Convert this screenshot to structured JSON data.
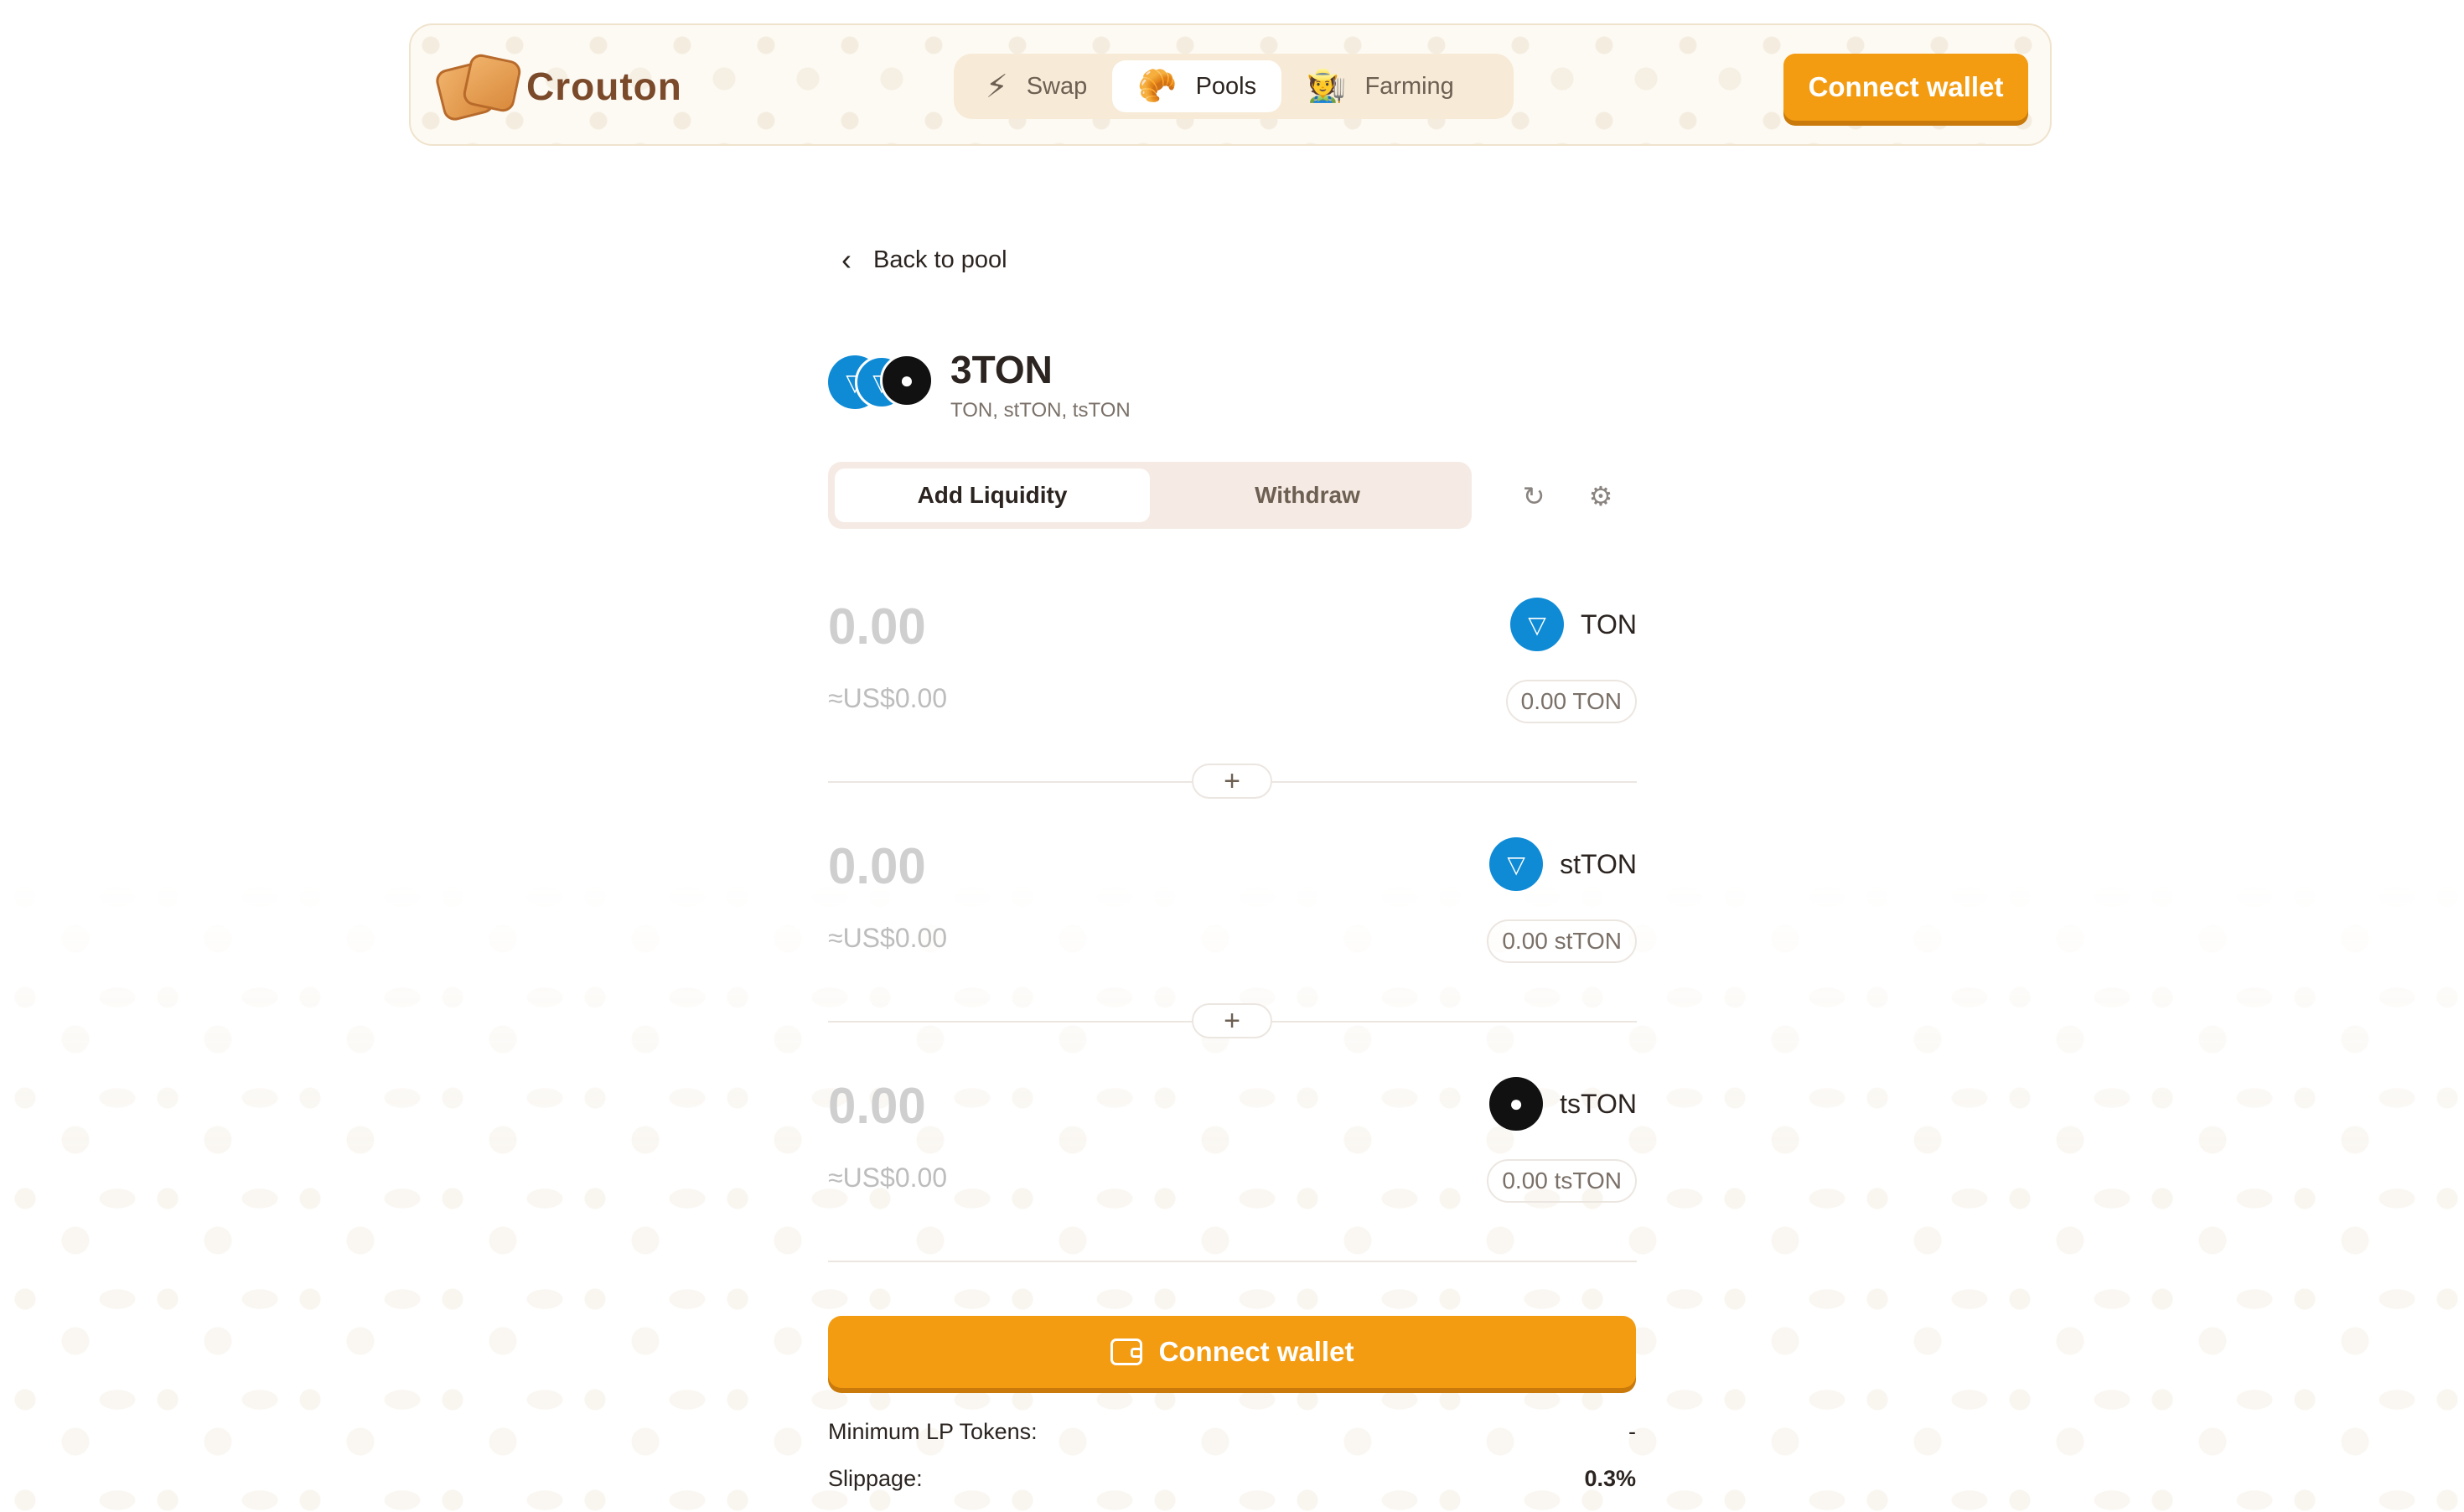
{
  "header": {
    "brand": "Crouton",
    "nav": [
      {
        "label": "Swap",
        "icon": "⚡"
      },
      {
        "label": "Pools",
        "icon": "🥐"
      },
      {
        "label": "Farming",
        "icon": "🧑‍🌾"
      }
    ],
    "connect_label": "Connect wallet"
  },
  "back_label": "Back to pool",
  "pool": {
    "name": "3TON",
    "tokens": "TON, stTON, tsTON"
  },
  "tabs": {
    "add": "Add Liquidity",
    "withdraw": "Withdraw"
  },
  "tools": {
    "refresh_icon": "↻",
    "settings_icon": "⚙"
  },
  "rows": [
    {
      "amount": "0.00",
      "usd": "≈US$0.00",
      "token": "TON",
      "balance": "0.00 TON"
    },
    {
      "amount": "0.00",
      "usd": "≈US$0.00",
      "token": "stTON",
      "balance": "0.00 stTON"
    },
    {
      "amount": "0.00",
      "usd": "≈US$0.00",
      "token": "tsTON",
      "balance": "0.00 tsTON"
    }
  ],
  "plus_symbol": "+",
  "connect_main_label": "Connect wallet",
  "info": {
    "min_lp_label": "Minimum LP Tokens:",
    "min_lp_value": "-",
    "slippage_label": "Slippage:",
    "slippage_value": "0.3%"
  },
  "colors": {
    "accent": "#f39c12",
    "ton_blue": "#0f8bd6",
    "tston_black": "#111111"
  }
}
